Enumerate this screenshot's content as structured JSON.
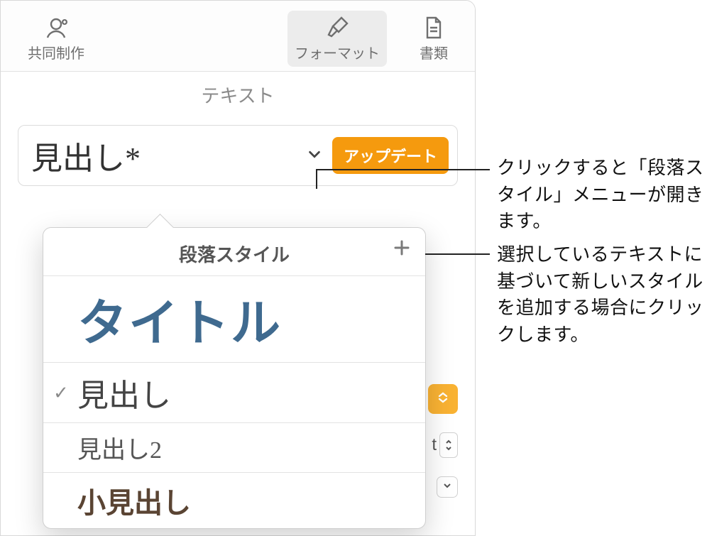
{
  "toolbar": {
    "collaborate_label": "共同制作",
    "format_label": "フォーマット",
    "document_label": "書類"
  },
  "text_tab_label": "テキスト",
  "style_field": {
    "current_name": "見出し*",
    "update_label": "アップデート"
  },
  "popover": {
    "title": "段落スタイル",
    "styles": {
      "title": "タイトル",
      "heading": "見出し",
      "heading2": "見出し2",
      "subheading": "小見出し"
    }
  },
  "bg_controls": {
    "stepper_suffix": "t"
  },
  "callouts": {
    "open_menu": "クリックすると「段落スタイル」メニューが開きます。",
    "add_style": "選択しているテキストに基づいて新しいスタイルを追加する場合にクリックします。"
  }
}
